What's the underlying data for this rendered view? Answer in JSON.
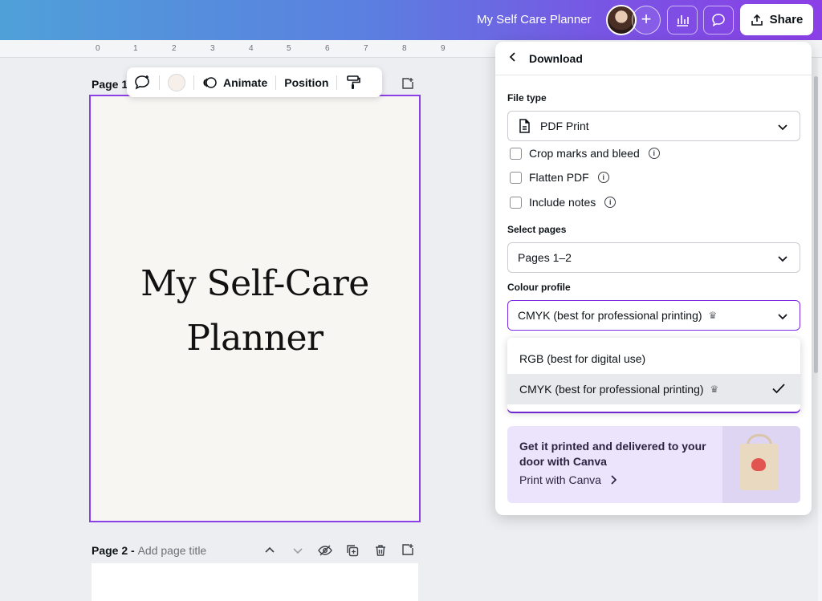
{
  "topbar": {
    "doc_title": "My Self Care Planner",
    "plus_symbol": "+",
    "share_label": "Share"
  },
  "ruler": {
    "marks": [
      "0",
      "1",
      "2",
      "3",
      "4",
      "5",
      "6",
      "7",
      "8",
      "9"
    ]
  },
  "canvas": {
    "page1_label": "Page 1",
    "page1_title_line1": "My Self-Care",
    "page1_title_line2": "Planner",
    "page2_label": "Page 2 -",
    "page2_placeholder": "Add page title"
  },
  "toolbar": {
    "animate_label": "Animate",
    "position_label": "Position"
  },
  "download_panel": {
    "back_icon": "chevron-left-icon",
    "title": "Download",
    "file_type_label": "File type",
    "file_type_value": "PDF Print",
    "checkboxes": [
      {
        "label": "Crop marks and bleed",
        "checked": false
      },
      {
        "label": "Flatten PDF",
        "checked": false
      },
      {
        "label": "Include notes",
        "checked": false
      }
    ],
    "select_pages_label": "Select pages",
    "select_pages_value": "Pages 1–2",
    "colour_profile_label": "Colour profile",
    "colour_profile_value": "CMYK (best for professional printing)",
    "colour_options": [
      {
        "label": "RGB (best for digital use)",
        "selected": false
      },
      {
        "label": "CMYK (best for professional printing)",
        "selected": true
      }
    ],
    "promo_title": "Get it printed and delivered to your door with Canva",
    "promo_link": "Print with Canva"
  },
  "colors": {
    "accent": "#7d2ae8",
    "promo_bg": "#ece4fd"
  }
}
